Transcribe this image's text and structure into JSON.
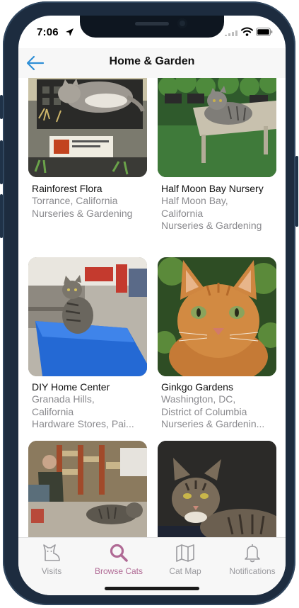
{
  "status_bar": {
    "time": "7:06"
  },
  "nav": {
    "title": "Home & Garden"
  },
  "places": [
    {
      "name": "Rainforest Flora",
      "location": [
        "Torrance, California"
      ],
      "category": "Nurseries & Gardening"
    },
    {
      "name": "Half Moon Bay Nursery",
      "location": [
        "Half Moon Bay,",
        "California"
      ],
      "category": "Nurseries & Gardening"
    },
    {
      "name": "DIY Home Center",
      "location": [
        "Granada Hills,",
        "California"
      ],
      "category": "Hardware Stores, Pai..."
    },
    {
      "name": "Ginkgo Gardens",
      "location": [
        "Washington, DC,",
        "District of Columbia"
      ],
      "category": "Nurseries & Gardenin..."
    }
  ],
  "tabs": [
    {
      "label": "Visits",
      "icon": "cat-icon"
    },
    {
      "label": "Browse Cats",
      "icon": "search-icon"
    },
    {
      "label": "Cat Map",
      "icon": "map-icon"
    },
    {
      "label": "Notifications",
      "icon": "bell-icon"
    }
  ],
  "colors": {
    "accent": "#b06a95",
    "back_arrow": "#2f8fd6",
    "inactive_tab": "#9a9a9e"
  }
}
